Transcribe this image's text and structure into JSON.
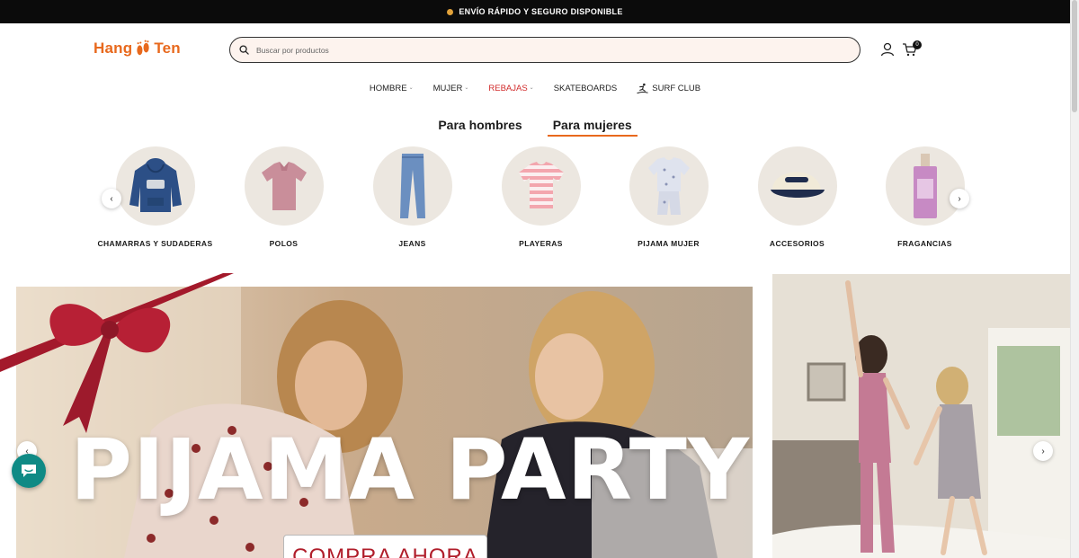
{
  "announcement": {
    "text": "ENVÍO RÁPIDO Y SEGURO DISPONIBLE"
  },
  "header": {
    "logo_left": "Hang",
    "logo_right": "Ten",
    "search_placeholder": "Buscar por productos",
    "cart_count": "0"
  },
  "nav": {
    "items": [
      {
        "label": "HOMBRE",
        "dropdown": true
      },
      {
        "label": "MUJER",
        "dropdown": true
      },
      {
        "label": "REBAJAS",
        "dropdown": true,
        "color": "#d12b2b"
      },
      {
        "label": "SKATEBOARDS",
        "dropdown": false
      },
      {
        "label": "SURF CLUB",
        "dropdown": false,
        "icon": "surfer-icon"
      }
    ]
  },
  "tabs": [
    {
      "label": "Para hombres",
      "active": false
    },
    {
      "label": "Para mujeres",
      "active": true
    }
  ],
  "categories": [
    {
      "label": "CHAMARRAS Y SUDADERAS",
      "icon": "hoodie-icon"
    },
    {
      "label": "POLOS",
      "icon": "polo-icon"
    },
    {
      "label": "JEANS",
      "icon": "jeans-icon"
    },
    {
      "label": "PLAYERAS",
      "icon": "tshirt-icon"
    },
    {
      "label": "PIJAMA MUJER",
      "icon": "pajama-icon"
    },
    {
      "label": "ACCESORIOS",
      "icon": "cap-icon"
    },
    {
      "label": "FRAGANCIAS",
      "icon": "perfume-icon"
    }
  ],
  "hero": {
    "title": "PIJAMA PARTY",
    "cta": "COMPRA AHORA"
  },
  "colors": {
    "brand_orange": "#e8691d",
    "sale_red": "#d12b2b",
    "chat_teal": "#0f8a85",
    "cta_red": "#b01d2a"
  }
}
